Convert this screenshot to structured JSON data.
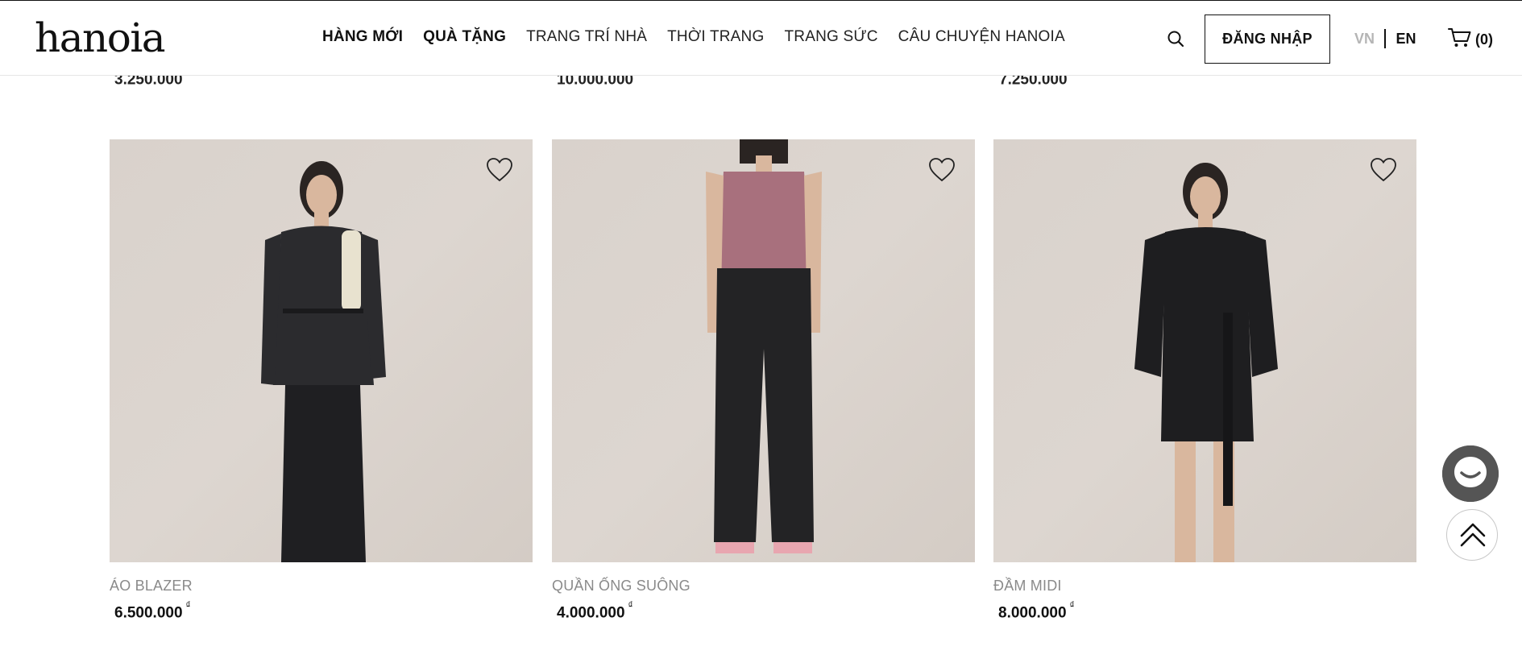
{
  "brand": {
    "logo_text": "hanoia"
  },
  "nav": {
    "items": [
      {
        "label": "HÀNG MỚI",
        "bold": true
      },
      {
        "label": "QUÀ TẶNG",
        "bold": true
      },
      {
        "label": "TRANG TRÍ NHÀ",
        "bold": false
      },
      {
        "label": "THỜI TRANG",
        "bold": false
      },
      {
        "label": "TRANG SỨC",
        "bold": false
      },
      {
        "label": "CÂU CHUYỆN HANOIA",
        "bold": false
      }
    ]
  },
  "header": {
    "login_label": "ĐĂNG NHẬP",
    "lang_vn": "VN",
    "lang_en": "EN",
    "cart_count": "(0)"
  },
  "previous_row": {
    "prices": [
      "3.250.000",
      "10.000.000",
      "7.250.000"
    ],
    "currency": "₫"
  },
  "products": [
    {
      "name": "ÁO BLAZER",
      "price": "6.500.000",
      "currency": "₫"
    },
    {
      "name": "QUẦN ỐNG SUÔNG",
      "price": "4.000.000",
      "currency": "₫"
    },
    {
      "name": "ĐẦM MIDI",
      "price": "8.000.000",
      "currency": "₫"
    }
  ],
  "icons": {
    "search": "search-icon",
    "cart": "cart-icon",
    "wishlist": "heart-icon",
    "chat": "chat-icon",
    "back_to_top": "double-chevron-up-icon"
  },
  "colors": {
    "text": "#111111",
    "muted": "#8a8a8a",
    "lang_inactive": "#b5b5b5",
    "photo_bg": "#d9d2cc"
  }
}
